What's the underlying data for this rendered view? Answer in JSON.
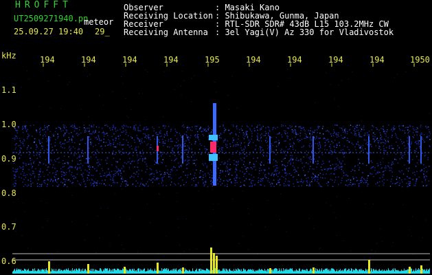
{
  "header": {
    "app_name": "HROFFT",
    "file_name": "UT2509271940.pn",
    "detection_label": "meteor",
    "timestamp": "25.09.27 19:40",
    "count": "29_"
  },
  "station_info": [
    {
      "label": "Observer",
      "value": ": Masaki Kano"
    },
    {
      "label": "Receiving Location",
      "value": ": Shibukawa, Gunma, Japan"
    },
    {
      "label": "Receiver",
      "value": ": RTL-SDR SDR# 43dB L15 103.2MHz CW"
    },
    {
      "label": "Receiving Antenna",
      "value": ": 3el Yagi(V) Az 330 for Vladivostok"
    }
  ],
  "time_axis": {
    "labels": [
      "194",
      "194",
      "194",
      "194",
      "195",
      "194",
      "194",
      "194",
      "194",
      "1950"
    ]
  },
  "freq_axis": {
    "unit": "kHz",
    "labels": [
      "1.1",
      "1.0",
      "0.9",
      "0.8",
      "0.7",
      "0.6"
    ]
  },
  "colors": {
    "background": "#000000",
    "title": "#2fd62f",
    "axis_text": "#e8e84a",
    "info_text": "#ffffff",
    "noise_band": "#1a2bb0",
    "signal_hot": "#ff2a6a",
    "spectrum_fill": "#e8e820",
    "spectrum_base": "#20d8e8"
  }
}
